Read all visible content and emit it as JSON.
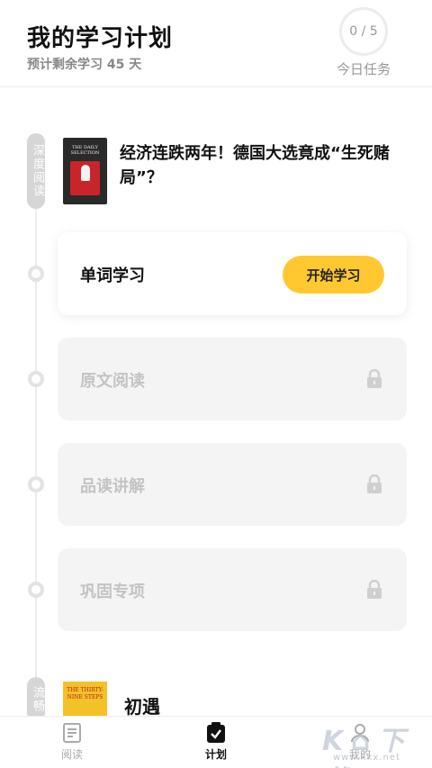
{
  "header": {
    "title": "我的学习计划",
    "subtitle": "预计剩余学习 45 天",
    "task_progress": "0 / 5",
    "task_label": "今日任务"
  },
  "deep_section": {
    "tag": "深度阅读",
    "book_cover_text": "THE DAILY SELECTION",
    "article_title": "经济连跌两年！德国大选竟成“生死赌局”？"
  },
  "steps": [
    {
      "label": "单词学习",
      "state": "active",
      "button": "开始学习"
    },
    {
      "label": "原文阅读",
      "state": "locked",
      "icon": "lock-icon"
    },
    {
      "label": "品读讲解",
      "state": "locked",
      "icon": "lock-icon"
    },
    {
      "label": "巩固专项",
      "state": "locked",
      "icon": "lock-icon"
    }
  ],
  "fluent_section": {
    "tag": "流畅",
    "book_cover_text": "THE THIRTY-NINE STEPS",
    "title": "初遇"
  },
  "tabbar": {
    "read": "阅读",
    "plan": "计划",
    "mine": "我的"
  },
  "watermark": {
    "main": "K ⌂ 下载",
    "url": "www.kkx.net"
  },
  "colors": {
    "accent": "#ffc831",
    "locked_bg": "#f4f4f4",
    "locked_text": "#c3c3c3"
  }
}
